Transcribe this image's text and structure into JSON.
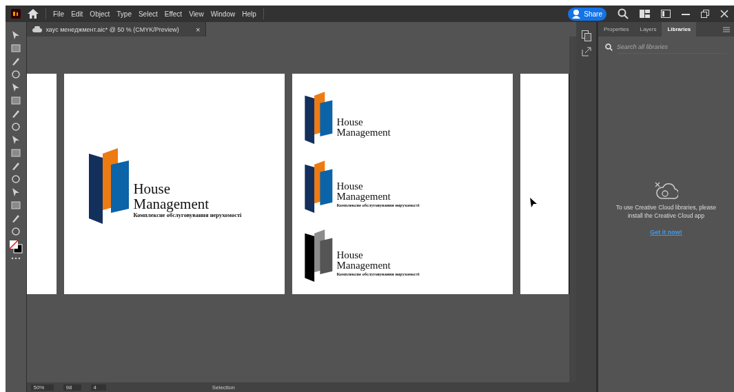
{
  "menu": [
    "File",
    "Edit",
    "Object",
    "Type",
    "Select",
    "Effect",
    "View",
    "Window",
    "Help"
  ],
  "share": "Share",
  "document_tab": {
    "title": "хаус менеджмент.aic* @ 50 % (CMYK/Preview)",
    "close": "×"
  },
  "artboards": [
    {
      "kind": "partial"
    },
    {
      "kind": "artboard",
      "logos": [
        {
          "kind": "color",
          "title": "House",
          "subtitle": "Management",
          "tagline": "Комплексне обслуговування нерухомості"
        }
      ]
    },
    {
      "kind": "artboard",
      "logos": [
        {
          "kind": "color",
          "title": "House",
          "subtitle": "Management"
        },
        {
          "kind": "color",
          "title": "House",
          "subtitle": "Management",
          "tagline": "Комплексне обслуговування нерухомості"
        },
        {
          "kind": "mono",
          "title": "House",
          "subtitle": "Management",
          "tagline": "Комплексне обслуговування нерухомості"
        }
      ]
    },
    {
      "kind": "narrow"
    }
  ],
  "panel": {
    "tabs": [
      {
        "label": "Properties",
        "selected": false
      },
      {
        "label": "Layers",
        "selected": false
      },
      {
        "label": "Libraries",
        "selected": true
      }
    ],
    "search": {
      "placeholder": "Search all libraries"
    },
    "message": "To use Creative Cloud libraries, please install the Creative Cloud app",
    "link": "Get it now!"
  },
  "status_bar": {
    "zoom": "50%",
    "rotation": "98",
    "artboard": "4",
    "tool": "Selection"
  }
}
